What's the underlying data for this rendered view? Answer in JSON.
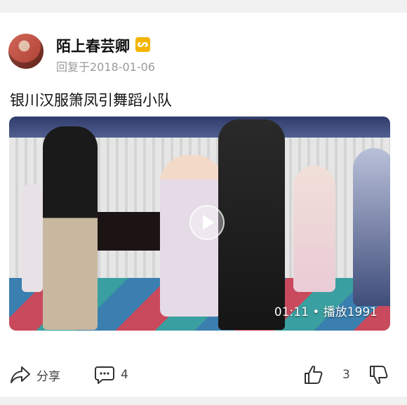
{
  "post": {
    "username": "陌上春芸卿",
    "badge": "ᔕ",
    "reply_date": "回复于2018-01-06",
    "title": "银川汉服箫凤引舞蹈小队"
  },
  "video": {
    "duration_play": "01:11 • 播放1991"
  },
  "actions": {
    "share_label": "分享",
    "comment_count": "4",
    "like_count": "3"
  },
  "icons": {
    "share": "share-icon",
    "comment": "comment-icon",
    "like": "thumbs-up-icon",
    "dislike": "thumbs-down-icon",
    "play": "play-icon"
  },
  "colors": {
    "badge": "#f4b400",
    "text_primary": "#111111",
    "text_secondary": "#9a9a9a"
  }
}
